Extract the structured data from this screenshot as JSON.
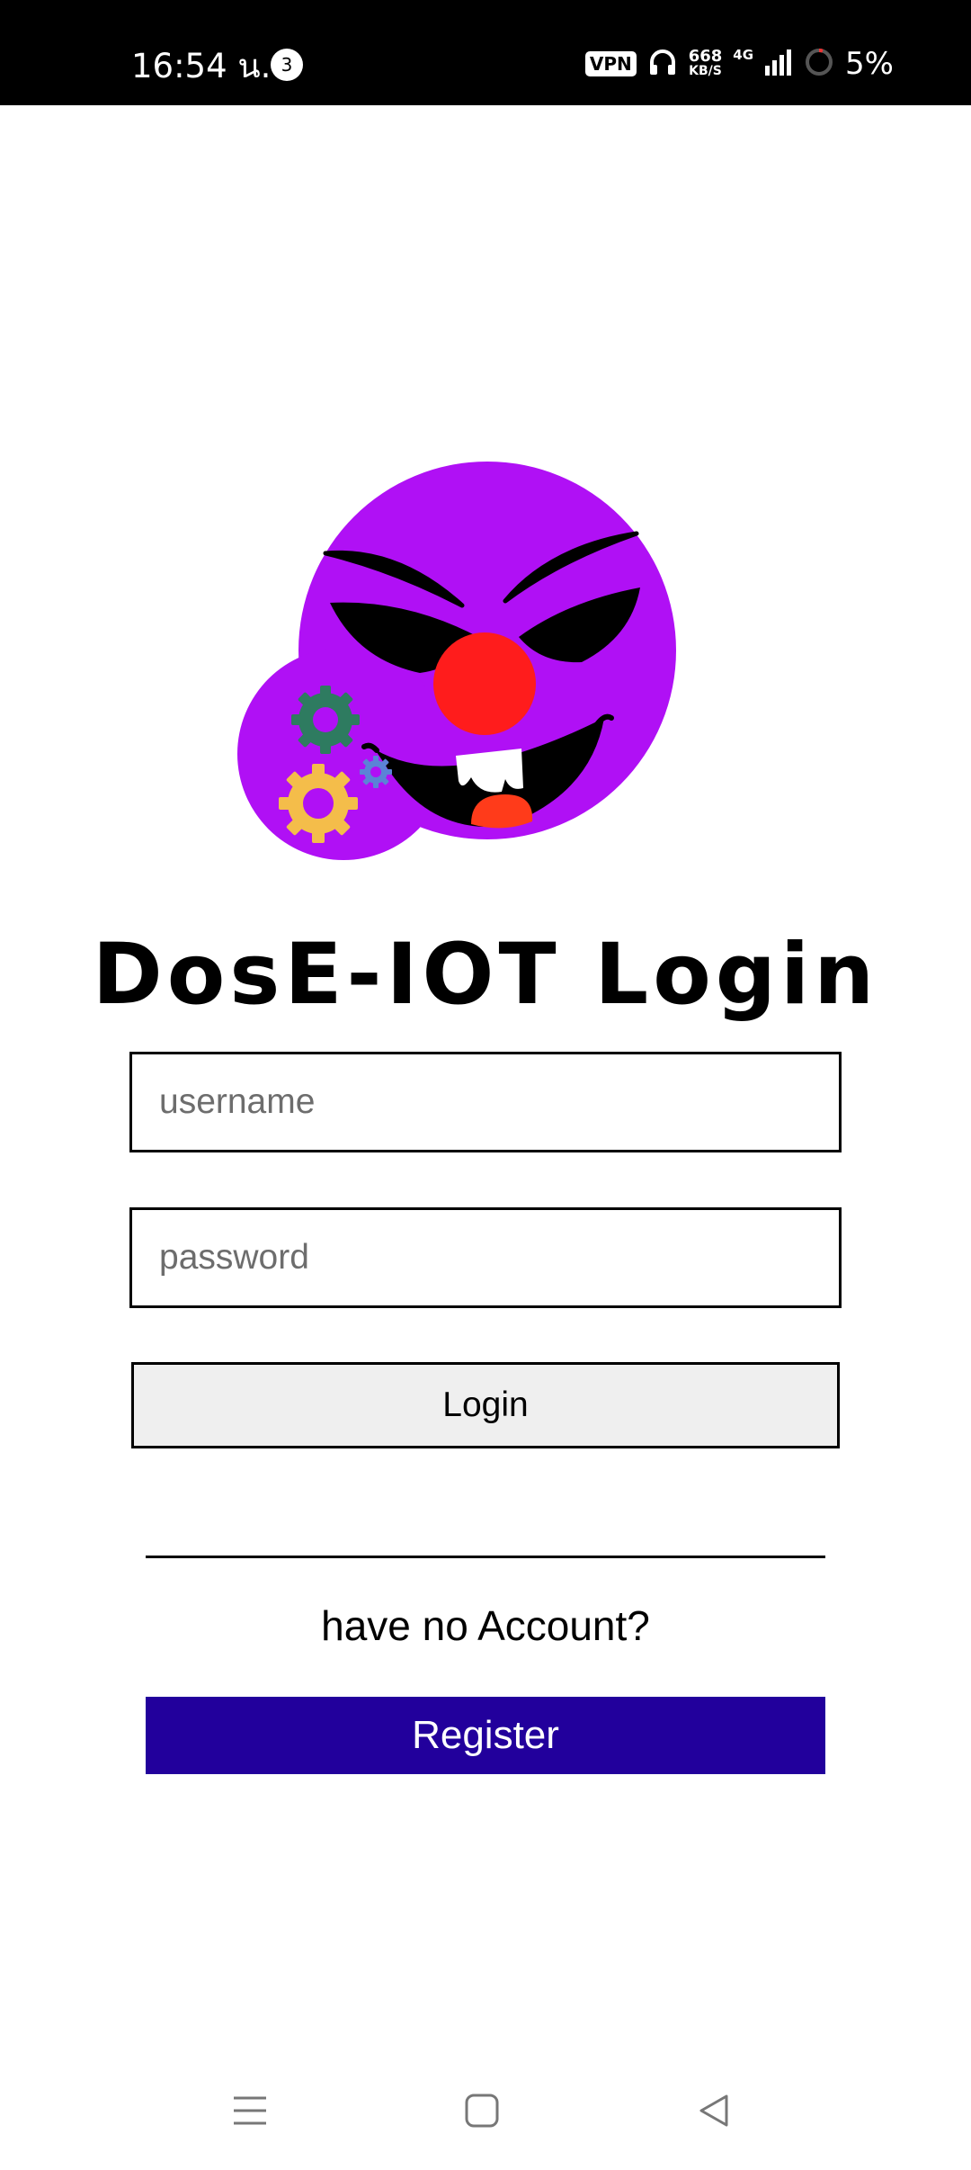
{
  "status_bar": {
    "time": "16:54 น.",
    "notification_count": "3",
    "vpn_label": "VPN",
    "net_speed": "668",
    "net_speed_unit": "KB/S",
    "network_type": "4G",
    "battery": "5%"
  },
  "logo": {
    "icon": "clown-face-with-gears-logo",
    "face_color": "#b010f5",
    "nose_color": "#ff1c1c"
  },
  "login": {
    "title": "DosE-IOT Login",
    "username_placeholder": "username",
    "password_placeholder": "password",
    "username_value": "",
    "password_value": "",
    "login_label": "Login",
    "no_account_text": "have no Account?",
    "register_label": "Register",
    "register_color": "#22009c"
  },
  "nav_bar": {
    "menu_icon": "menu-icon",
    "home_icon": "home-icon",
    "back_icon": "back-icon"
  }
}
